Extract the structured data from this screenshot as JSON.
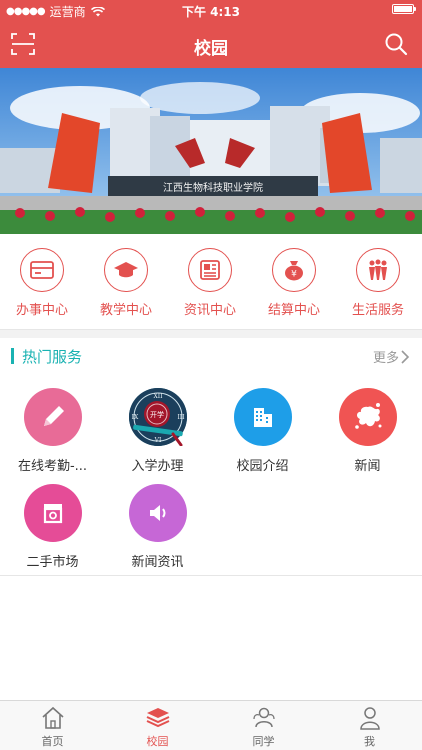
{
  "status_bar": {
    "carrier": "运营商",
    "time": "下午 4:13"
  },
  "nav": {
    "title": "校园",
    "left_icon": "scan-icon",
    "right_icon": "search-icon"
  },
  "banner": {
    "sign_text": "江西生物科技职业学院",
    "building_text": "江西生物科技职业学院"
  },
  "quick_menu": [
    {
      "label": "办事中心",
      "icon": "card-icon"
    },
    {
      "label": "教学中心",
      "icon": "graduation-cap-icon"
    },
    {
      "label": "资讯中心",
      "icon": "newspaper-icon"
    },
    {
      "label": "结算中心",
      "icon": "money-bag-icon"
    },
    {
      "label": "生活服务",
      "icon": "people-icon"
    }
  ],
  "hot_services": {
    "title": "热门服务",
    "more": "更多",
    "items": [
      {
        "label": "在线考勤-...",
        "icon": "pencil-icon",
        "color": "#e86b97"
      },
      {
        "label": "入学办理",
        "icon": "clock-stamp-icon",
        "color": "#1aa9b0",
        "stamp_text": "开学"
      },
      {
        "label": "校园介绍",
        "icon": "building-icon",
        "color": "#1e9ee8"
      },
      {
        "label": "新闻",
        "icon": "splash-icon",
        "color": "#f05453"
      },
      {
        "label": "二手市场",
        "icon": "market-icon",
        "color": "#e54c97"
      },
      {
        "label": "新闻资讯",
        "icon": "speaker-icon",
        "color": "#c667d6"
      }
    ]
  },
  "tabs": [
    {
      "label": "首页",
      "icon": "home-icon",
      "active": false
    },
    {
      "label": "校园",
      "icon": "layers-icon",
      "active": true
    },
    {
      "label": "同学",
      "icon": "classmates-icon",
      "active": false
    },
    {
      "label": "我",
      "icon": "user-icon",
      "active": false
    }
  ],
  "colors": {
    "primary": "#e3514f",
    "accent": "#19b2b2"
  }
}
